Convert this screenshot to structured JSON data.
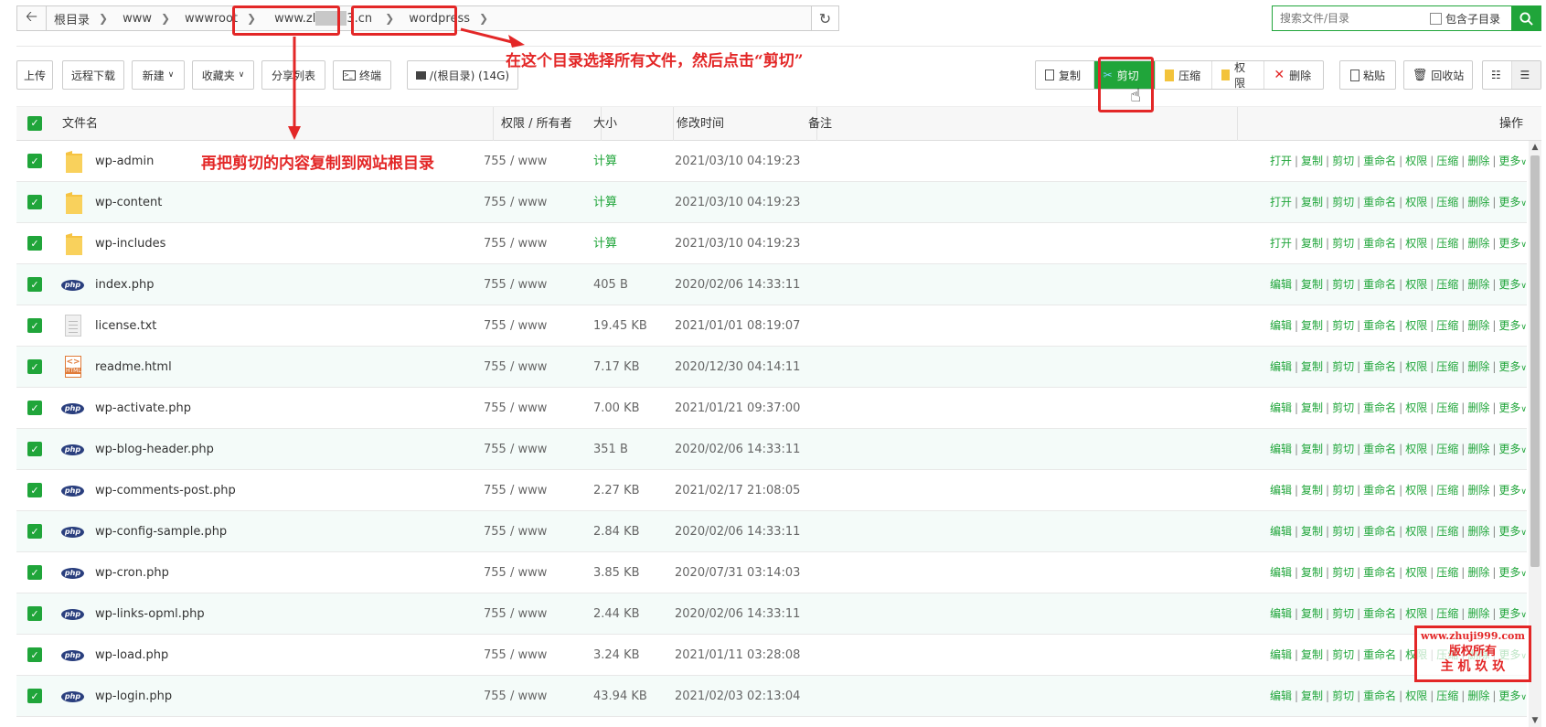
{
  "pathbar": {
    "back_icon": "arrow-left-icon",
    "crumbs": [
      "根目录",
      "www",
      "wwwroot",
      "www.zl",
      "3.cn",
      "wordpress"
    ],
    "refresh_icon": "refresh-icon"
  },
  "search": {
    "placeholder": "搜索文件/目录",
    "include_sub_label": "包含子目录",
    "search_icon": "search-icon"
  },
  "toolbar": {
    "upload": "上传",
    "remote_download": "远程下载",
    "new": "新建",
    "favorites": "收藏夹",
    "share_list": "分享列表",
    "terminal": "终端",
    "disk": "/(根目录) (14G)",
    "copy": "复制",
    "cut": "剪切",
    "compress": "压缩",
    "permission": "权限",
    "delete": "删除",
    "paste": "粘贴",
    "recycle": "回收站",
    "accent": "#20a53a"
  },
  "table": {
    "headers": {
      "name": "文件名",
      "perm": "权限 / 所有者",
      "size": "大小",
      "mtime": "修改时间",
      "note": "备注",
      "ops": "操作"
    },
    "rows": [
      {
        "type": "folder",
        "name": "wp-admin",
        "perm": "755 / www",
        "size": "计算",
        "mtime": "2021/03/10 04:19:23"
      },
      {
        "type": "folder",
        "name": "wp-content",
        "perm": "755 / www",
        "size": "计算",
        "mtime": "2021/03/10 04:19:23"
      },
      {
        "type": "folder",
        "name": "wp-includes",
        "perm": "755 / www",
        "size": "计算",
        "mtime": "2021/03/10 04:19:23"
      },
      {
        "type": "php",
        "name": "index.php",
        "perm": "755 / www",
        "size": "405 B",
        "mtime": "2020/02/06 14:33:11"
      },
      {
        "type": "txt",
        "name": "license.txt",
        "perm": "755 / www",
        "size": "19.45 KB",
        "mtime": "2021/01/01 08:19:07"
      },
      {
        "type": "html",
        "name": "readme.html",
        "perm": "755 / www",
        "size": "7.17 KB",
        "mtime": "2020/12/30 04:14:11"
      },
      {
        "type": "php",
        "name": "wp-activate.php",
        "perm": "755 / www",
        "size": "7.00 KB",
        "mtime": "2021/01/21 09:37:00"
      },
      {
        "type": "php",
        "name": "wp-blog-header.php",
        "perm": "755 / www",
        "size": "351 B",
        "mtime": "2020/02/06 14:33:11"
      },
      {
        "type": "php",
        "name": "wp-comments-post.php",
        "perm": "755 / www",
        "size": "2.27 KB",
        "mtime": "2021/02/17 21:08:05"
      },
      {
        "type": "php",
        "name": "wp-config-sample.php",
        "perm": "755 / www",
        "size": "2.84 KB",
        "mtime": "2020/02/06 14:33:11"
      },
      {
        "type": "php",
        "name": "wp-cron.php",
        "perm": "755 / www",
        "size": "3.85 KB",
        "mtime": "2020/07/31 03:14:03"
      },
      {
        "type": "php",
        "name": "wp-links-opml.php",
        "perm": "755 / www",
        "size": "2.44 KB",
        "mtime": "2020/02/06 14:33:11"
      },
      {
        "type": "php",
        "name": "wp-load.php",
        "perm": "755 / www",
        "size": "3.24 KB",
        "mtime": "2021/01/11 03:28:08"
      },
      {
        "type": "php",
        "name": "wp-login.php",
        "perm": "755 / www",
        "size": "43.94 KB",
        "mtime": "2021/02/03 02:13:04"
      }
    ],
    "ops_folder": [
      "打开",
      "复制",
      "剪切",
      "重命名",
      "权限",
      "压缩",
      "删除",
      "更多"
    ],
    "ops_file": [
      "编辑",
      "复制",
      "剪切",
      "重命名",
      "权限",
      "压缩",
      "删除",
      "更多"
    ]
  },
  "annotations": {
    "top": "在这个目录选择所有文件，然后点击“剪切”",
    "middle": "再把剪切的内容复制到网站根目录"
  },
  "watermark": {
    "line1": "www.zhuji999.com",
    "line2": "版权所有",
    "line3": "主 机 玖 玖"
  }
}
